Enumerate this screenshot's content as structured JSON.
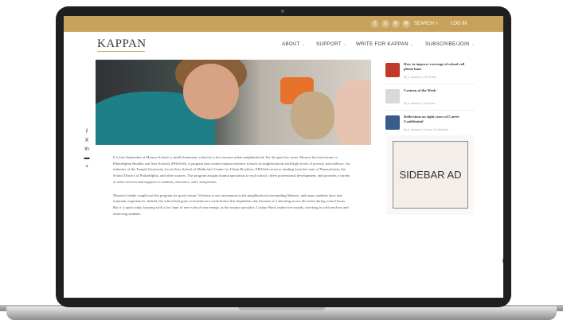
{
  "topbar": {
    "social_icons": [
      "facebook-icon",
      "x-icon",
      "linkedin-icon",
      "email-icon"
    ],
    "social_glyphs": [
      "f",
      "X",
      "in",
      "✉"
    ],
    "search_label": "SEARCH",
    "login_label": "LOG IN"
  },
  "brand": {
    "logo": "KAPPAN",
    "accent": "#c8a25b"
  },
  "nav": [
    {
      "label": "ABOUT"
    },
    {
      "label": "SUPPORT"
    },
    {
      "label": "WRITE FOR KAPPAN"
    },
    {
      "label": "SUBSCRIBE/JOIN"
    }
  ],
  "share": {
    "icons": [
      "facebook-icon",
      "x-icon",
      "linkedin-icon",
      "print-icon",
      "plus-icon"
    ],
    "glyphs": [
      "f",
      "X",
      "in",
      "▬",
      "+"
    ]
  },
  "article": {
    "paragraphs": [
      "It is late September at Monroe School, a small elementary school in a low-income urban neighborhood. For the past few years, Monroe has been home to Philadelphia Healthy and Safe Schools (PHASeS), a program that creates trauma-sensitive schools in neighborhoods with high levels of poverty and violence. An initiative of the Temple University Lewis Katz School of Medicine's Center for Urban Bioethics, PHASeS receives funding from the state of Pennsylvania, the School District of Philadelphia, and other sources. The program assigns trauma specialists to each school, offers professional development, and provides a variety of other services and supports to students, educators, staff, and parents.",
      "Monroe's leader sought out this program for good reason: Violence is not uncommon in the neighborhood surrounding Monroe, and many students have had traumatic experiences. Indeed, the school had gone on lockdown a week before this September day because of a shooting across the street during school hours. But it is quiet today, buzzing with a low hum of new-school-year energy, as the trauma specialist, Lashay Ward, makes her rounds, checking in with teachers and observing students."
    ]
  },
  "sidebar": {
    "items": [
      {
        "title": "How to improve coverage of school cell phone bans",
        "meta": "By a. strasser | The Briefs",
        "thumb_color": "#c0392b"
      },
      {
        "title": "Cartoon of the Week",
        "meta": "By a. strasser | Cartoons",
        "thumb_color": "#d9d9d9"
      },
      {
        "title": "Reflections on eight years of Career Confidential",
        "meta": "By a. strasser | Career Confidential",
        "thumb_color": "#3a5b8c"
      }
    ],
    "ad_label": "SIDEBAR AD"
  }
}
